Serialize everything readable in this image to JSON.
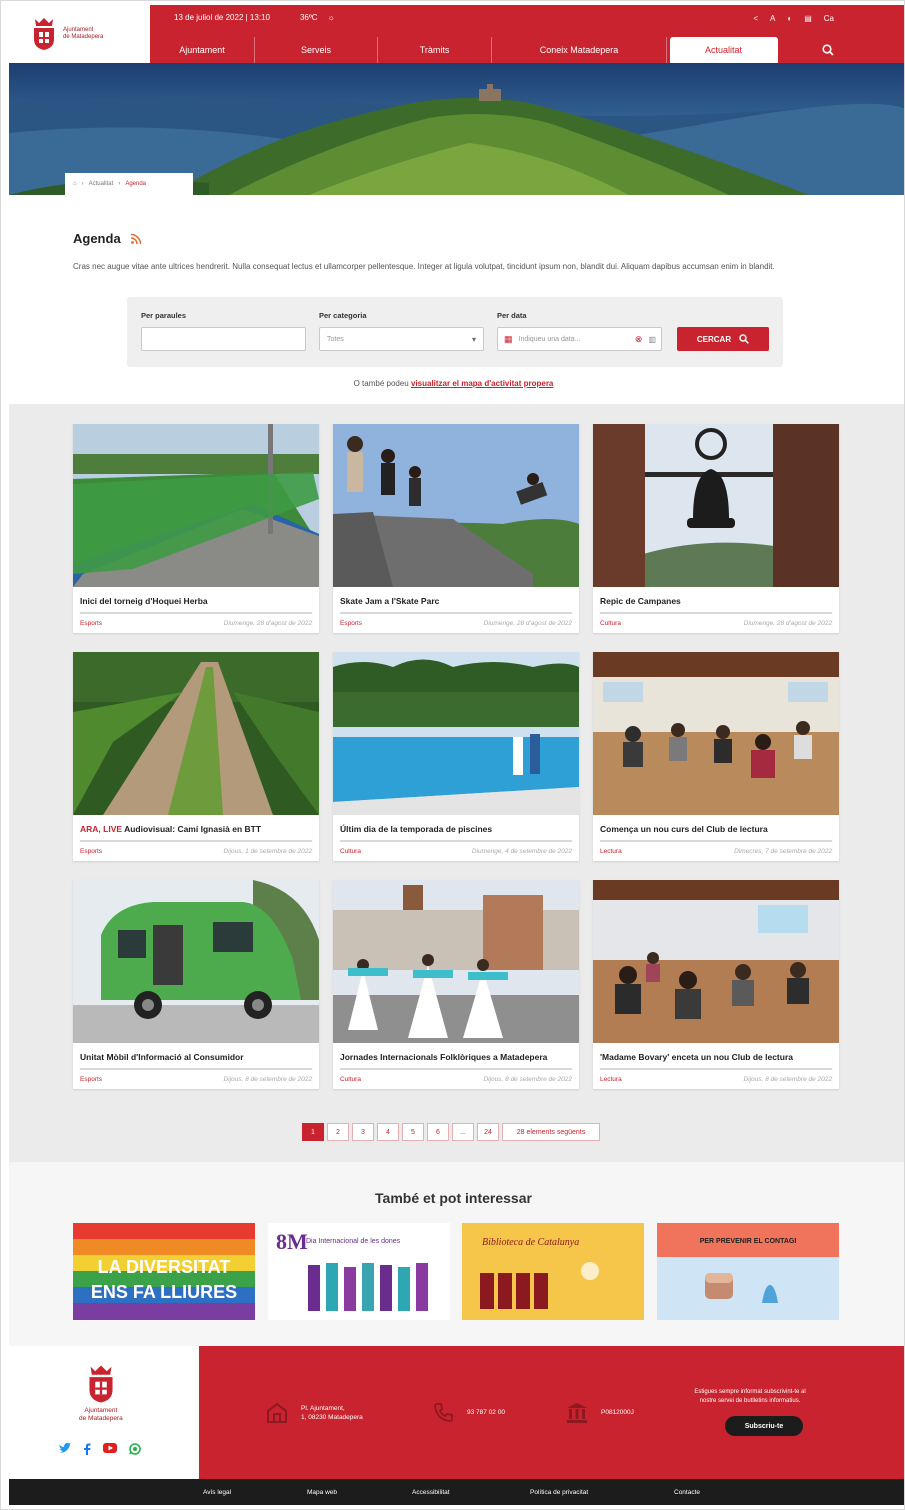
{
  "header": {
    "logo_line1": "Ajuntament",
    "logo_line2": "de Matadepera",
    "datetime": "13 de juliol de 2022 | 13:10",
    "weather": "36ºC",
    "lang": "Ca",
    "nav": [
      "Ajuntament",
      "Serveis",
      "Tràmits",
      "Coneix Matadepera",
      "Actualitat"
    ],
    "active_nav": "Actualitat"
  },
  "breadcrumb": [
    "Actualitat",
    "Agenda"
  ],
  "page": {
    "title": "Agenda",
    "intro": "Cras nec augue vitae ante ultrices hendrerit. Nulla consequat lectus et ullamcorper pellentesque. Integer at ligula volutpat, tincidunt ipsum non, blandit dui. Aliquam dapibus accumsan enim in blandit."
  },
  "filters": {
    "keywords_label": "Per paraules",
    "keywords_value": "",
    "category_label": "Per categoria",
    "category_value": "Totes",
    "date_label": "Per data",
    "date_placeholder": "Indiqueu una data...",
    "search_label": "CERCAR"
  },
  "alt_link": {
    "prefix": "O també podeu",
    "link": "visualitzar el mapa d'activitat propera"
  },
  "cards": [
    {
      "title": "Inici del torneig d'Hoquei Herba",
      "live": "",
      "category": "Esports",
      "date": "Diumenge, 28 d'agost de 2022"
    },
    {
      "title": "Skate Jam a l'Skate Parc",
      "live": "",
      "category": "Esports",
      "date": "Diumenge, 28 d'agost de 2022"
    },
    {
      "title": "Repic de Campanes",
      "live": "",
      "category": "Cultura",
      "date": "Diumenge, 28 d'agost de 2022"
    },
    {
      "title": "Audiovisual: Camí Ignasià en BTT",
      "live": "ARA, LIVE",
      "category": "Esports",
      "date": "Dijous, 1 de setembre de 2022"
    },
    {
      "title": "Últim dia de la temporada de piscines",
      "live": "",
      "category": "Cultura",
      "date": "Diumenge, 4 de setembre de 2022"
    },
    {
      "title": "Comença un nou curs del Club de lectura",
      "live": "",
      "category": "Lectura",
      "date": "Dimecres, 7 de setembre de 2022"
    },
    {
      "title": "Unitat Mòbil d'Informació al Consumidor",
      "live": "",
      "category": "Esports",
      "date": "Dijous, 8 de setembre de 2022"
    },
    {
      "title": "Jornades Internacionals Folklòriques a Matadepera",
      "live": "",
      "category": "Cultura",
      "date": "Dijous, 8 de setembre de 2022"
    },
    {
      "title": "'Madame Bovary' enceta un nou Club de lectura",
      "live": "",
      "category": "Lectura",
      "date": "Dijous, 8 de setembre de 2022"
    }
  ],
  "pagination": {
    "pages": [
      "1",
      "2",
      "3",
      "4",
      "5",
      "6",
      "...",
      "24"
    ],
    "current": "1",
    "next_label": "28 elements següents"
  },
  "related": {
    "title": "També et pot interessar",
    "banners": [
      {
        "line1": "LA DIVERSITAT",
        "line2": "ENS FA LLIURES"
      },
      {
        "big": "8M",
        "text": "Dia Internacional de les dones"
      },
      {
        "text": "Biblioteca de Catalunya"
      },
      {
        "text": "PER PREVENIR EL CONTAGI"
      }
    ]
  },
  "footer": {
    "logo_line1": "Ajuntament",
    "logo_line2": "de Matadepera",
    "address_line1": "Pl. Ajuntament,",
    "address_line2": "1, 08230 Matadepera",
    "phone": "93 787 02 00",
    "nif": "P0812000J",
    "subscribe_text": "Estigues sempre informat subscrivint-te al nostre servei de butlletins informatius.",
    "subscribe_label": "Subscriu-te",
    "bottom_links": [
      "Avís legal",
      "Mapa web",
      "Accessibilitat",
      "Política de privacitat",
      "Contacte"
    ]
  },
  "colors": {
    "brand_red": "#c8232e",
    "dark": "#1c1c1c",
    "grid_bg": "#ebebeb"
  }
}
